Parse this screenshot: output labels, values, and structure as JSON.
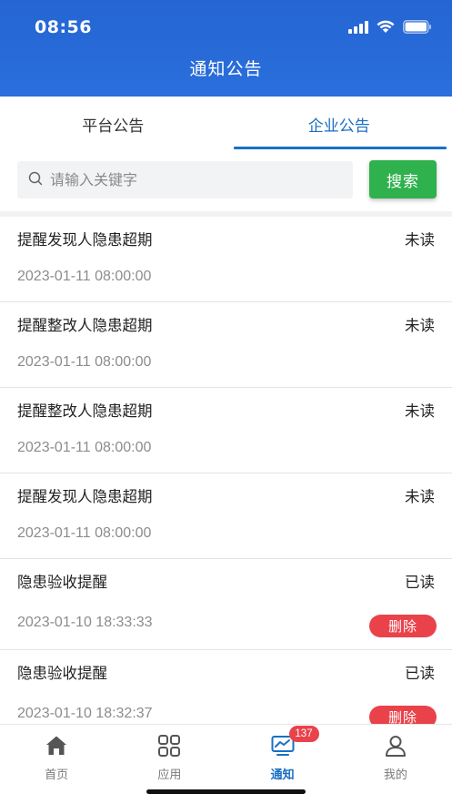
{
  "status_bar": {
    "time": "08:56"
  },
  "header": {
    "title": "通知公告"
  },
  "tabs": [
    {
      "label": "平台公告",
      "active": false
    },
    {
      "label": "企业公告",
      "active": true
    }
  ],
  "search": {
    "placeholder": "请输入关键字",
    "value": "",
    "button_label": "搜索"
  },
  "notices": [
    {
      "title": "提醒发现人隐患超期",
      "status": "未读",
      "date": "2023-01-11 08:00:00"
    },
    {
      "title": "提醒整改人隐患超期",
      "status": "未读",
      "date": "2023-01-11 08:00:00"
    },
    {
      "title": "提醒整改人隐患超期",
      "status": "未读",
      "date": "2023-01-11 08:00:00"
    },
    {
      "title": "提醒发现人隐患超期",
      "status": "未读",
      "date": "2023-01-11 08:00:00"
    },
    {
      "title": "隐患验收提醒",
      "status": "已读",
      "date": "2023-01-10 18:33:33",
      "delete_label": "删除"
    },
    {
      "title": "隐患验收提醒",
      "status": "已读",
      "date": "2023-01-10 18:32:37",
      "delete_label": "删除"
    }
  ],
  "tabbar": {
    "items": [
      {
        "label": "首页",
        "icon": "home-icon",
        "active": false
      },
      {
        "label": "应用",
        "icon": "grid-icon",
        "active": false
      },
      {
        "label": "通知",
        "icon": "monitor-chart-icon",
        "active": true,
        "badge": "137"
      },
      {
        "label": "我的",
        "icon": "user-icon",
        "active": false
      }
    ]
  },
  "colors": {
    "header_blue": "#2465d3",
    "accent_blue": "#1a6fc4",
    "search_green": "#2fb14d",
    "delete_red": "#e9424a",
    "badge_red": "#e9424a"
  }
}
